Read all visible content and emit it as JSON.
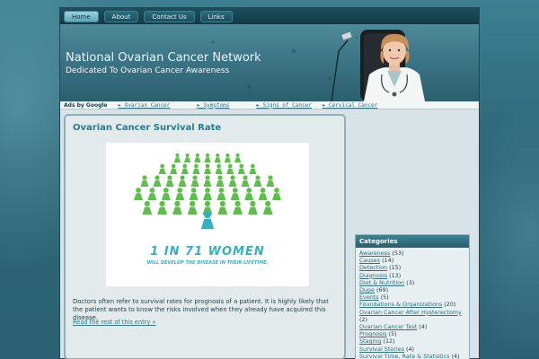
{
  "nav": {
    "items": [
      {
        "label": "Home",
        "active": true
      },
      {
        "label": "About",
        "active": false
      },
      {
        "label": "Contact Us",
        "active": false
      },
      {
        "label": "Links",
        "active": false
      }
    ]
  },
  "header": {
    "title": "National Ovarian Cancer Network",
    "tagline": "Dedicated To Ovarian Cancer Awareness"
  },
  "ads": {
    "ads_by": "Ads by Google",
    "links": [
      "► Ovarian Cancer",
      "► Symptoms",
      "► Signs of Cancer",
      "► Cervical Cancer"
    ]
  },
  "post": {
    "title": "Ovarian Cancer Survival Rate",
    "image_stat": "1 IN 71 WOMEN",
    "image_sub": "WILL DEVELOP THE DISEASE IN THEIR LIFETIME.",
    "body": "Doctors often refer to survival rates for prognosis of a patient. It is highly likely that the patient wants to know the risks involved when they already have acquired this disease.",
    "read_more": "Read the rest of this entry »"
  },
  "sidebar": {
    "categories_title": "Categories",
    "categories": [
      {
        "name": "Awareness",
        "count": "(53)"
      },
      {
        "name": "Causes",
        "count": "(14)"
      },
      {
        "name": "Detection",
        "count": "(15)"
      },
      {
        "name": "Diagnosis",
        "count": "(13)"
      },
      {
        "name": "Diet & Nutrition",
        "count": "(3)"
      },
      {
        "name": "Dupe",
        "count": "(69)"
      },
      {
        "name": "Events",
        "count": "(5)"
      },
      {
        "name": "Foundations & Organizations",
        "count": "(20)"
      },
      {
        "name": "Ovarian Cancer After Hysterectomy",
        "count": "(2)"
      },
      {
        "name": "Ovarian Cancer Test",
        "count": "(4)"
      },
      {
        "name": "Prognosis",
        "count": "(5)"
      },
      {
        "name": "Staging",
        "count": "(12)"
      },
      {
        "name": "Survival Stories",
        "count": "(4)"
      },
      {
        "name": "Survival Time, Rate & Statistics",
        "count": "(4)"
      }
    ]
  },
  "colors": {
    "accent": "#35b0c3",
    "background": "#2f6a7b",
    "figures": "#5cbf4a"
  }
}
